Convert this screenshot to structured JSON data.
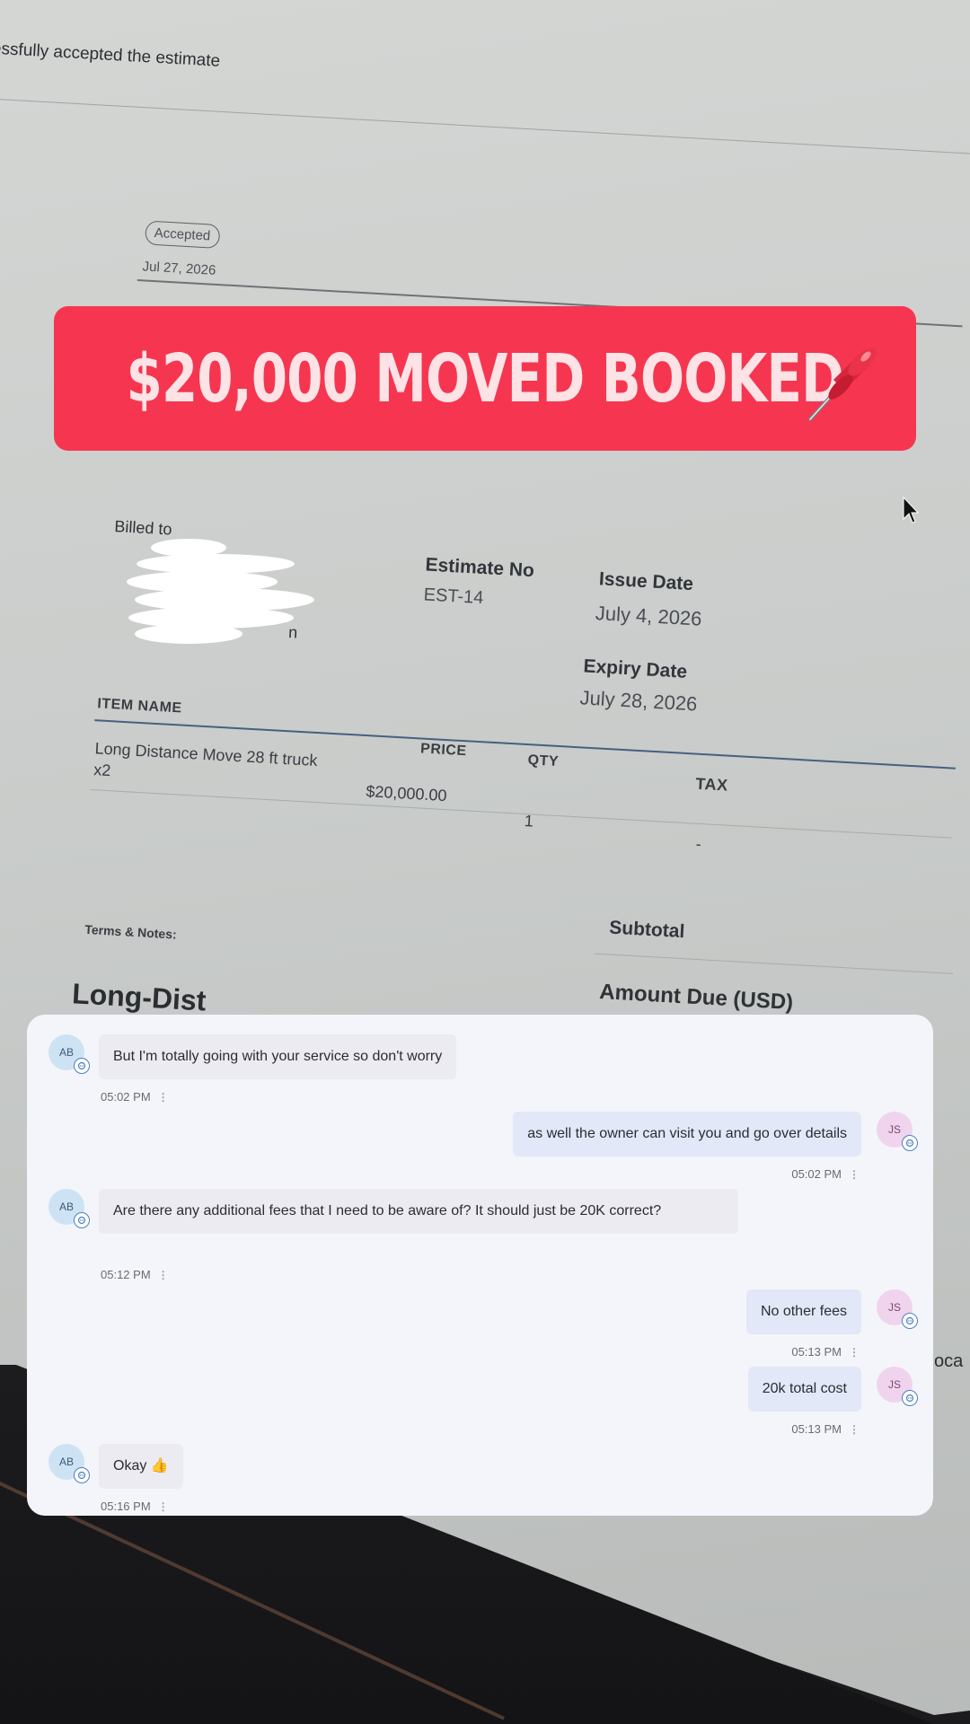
{
  "estimate": {
    "top_banner_text": "essfully accepted the estimate",
    "status_badge": "Accepted",
    "accepted_date": "Jul 27, 2026",
    "billed_to_label": "Billed to",
    "billed_to_fragment": "n",
    "estimate_no_label": "Estimate No",
    "estimate_no": "EST-14",
    "issue_date_label": "Issue Date",
    "issue_date": "July 4, 2026",
    "expiry_date_label": "Expiry Date",
    "expiry_date": "July 28, 2026",
    "table": {
      "columns": [
        "ITEM NAME",
        "PRICE",
        "QTY",
        "TAX"
      ],
      "rows": [
        {
          "item": "Long Distance Move 28 ft truck",
          "item_sub": "x2",
          "price": "$20,000.00",
          "qty": "1",
          "tax": "-"
        }
      ]
    },
    "terms_label": "Terms & Notes:",
    "terms_fragment": "Long-Dist",
    "subtotal_label": "Subtotal",
    "amount_due_label": "Amount Due (USD)"
  },
  "headline": {
    "text": "$20,000 MOVED BOOKED",
    "icon": "pushpin-icon",
    "background": "#f63650"
  },
  "chat": {
    "messages": [
      {
        "direction": "in",
        "avatar": "AB",
        "text": "But I'm totally going with your service so don't worry",
        "time": "05:02 PM"
      },
      {
        "direction": "out",
        "avatar": "JS",
        "text": "as well the owner can visit you and go over details",
        "time": "05:02 PM"
      },
      {
        "direction": "in",
        "avatar": "AB",
        "text": "Are there any additional fees that I need to be aware of? It should just be 20K correct?",
        "time": "05:12 PM"
      },
      {
        "direction": "out",
        "avatar": "JS",
        "text": "No other fees",
        "time": "05:13 PM"
      },
      {
        "direction": "out",
        "avatar": "JS",
        "text": "20k total cost",
        "time": "05:13 PM"
      },
      {
        "direction": "in",
        "avatar": "AB",
        "text": "Okay 👍",
        "time": "05:16 PM"
      }
    ],
    "kebab": "⋮"
  },
  "side_fragment": "oca"
}
